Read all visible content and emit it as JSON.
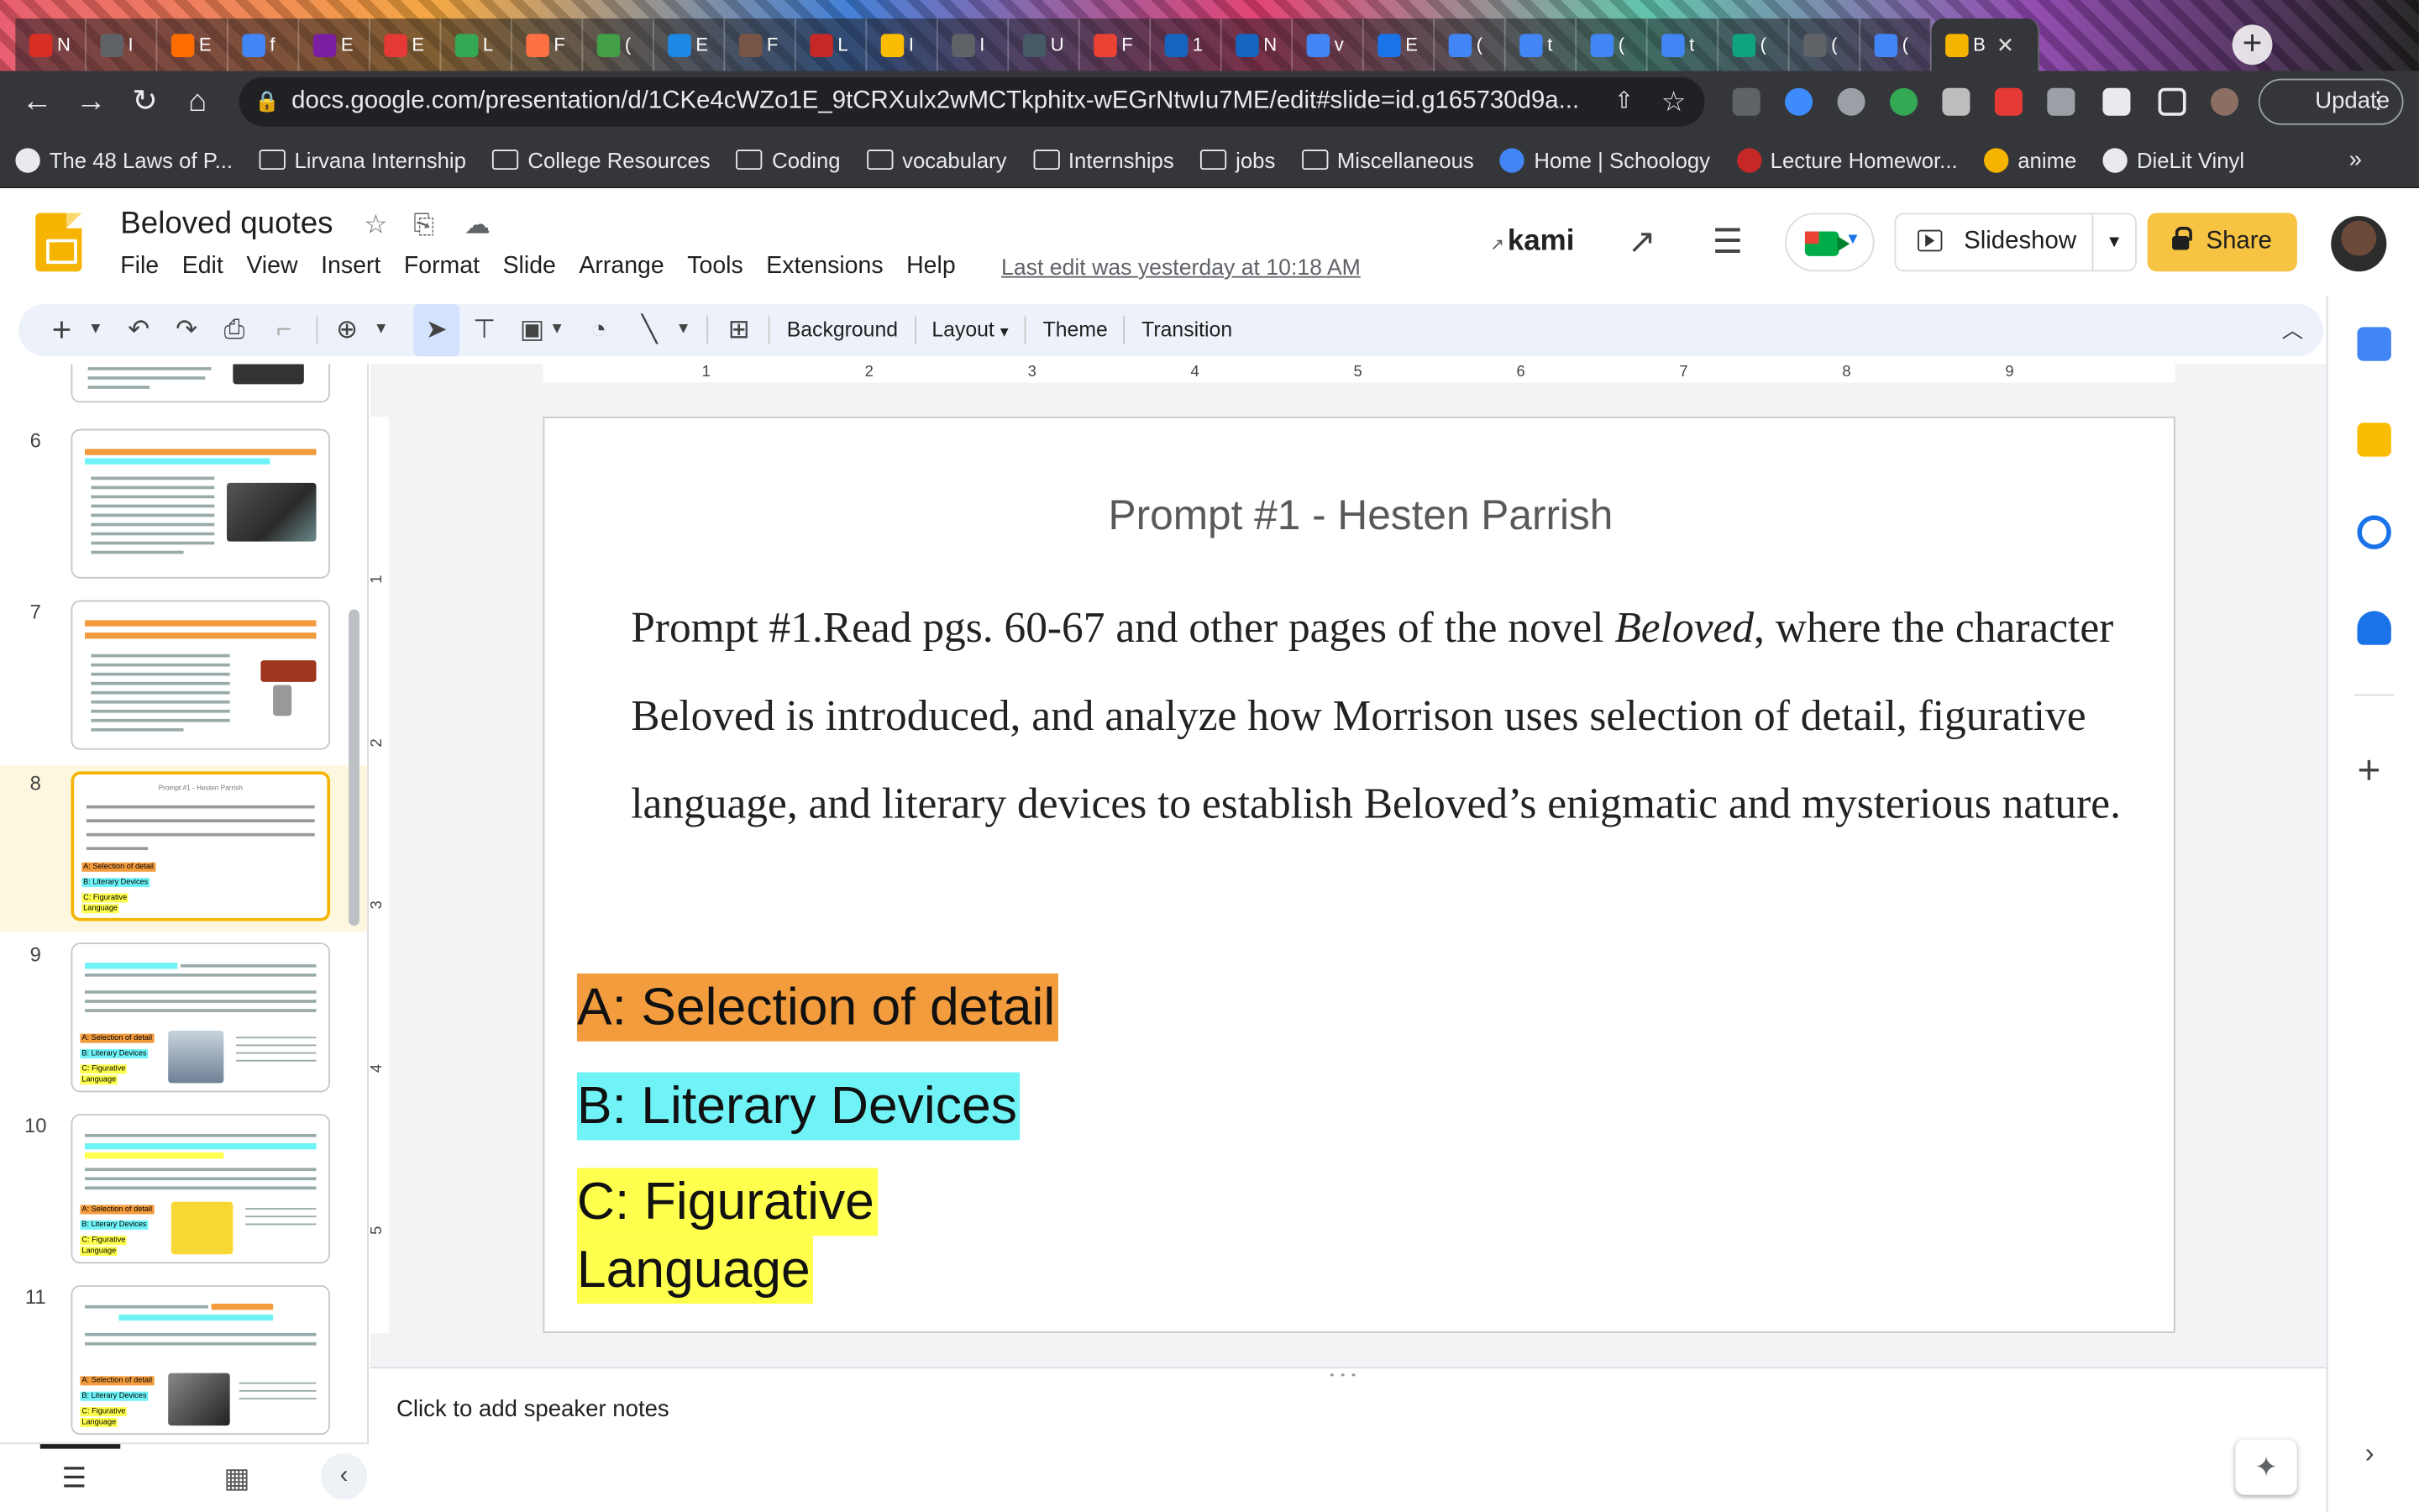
{
  "browser": {
    "tabs": [
      {
        "label": "N",
        "color": "#d93025"
      },
      {
        "label": "I",
        "color": "#5f6368"
      },
      {
        "label": "E",
        "color": "#ff6d00"
      },
      {
        "label": "f",
        "color": "#4285f4"
      },
      {
        "label": "E",
        "color": "#7b1fa2"
      },
      {
        "label": "E",
        "color": "#e53935"
      },
      {
        "label": "L",
        "color": "#34a853"
      },
      {
        "label": "F",
        "color": "#ff7043"
      },
      {
        "label": "(",
        "color": "#43a047"
      },
      {
        "label": "E",
        "color": "#1e88e5"
      },
      {
        "label": "F",
        "color": "#795548"
      },
      {
        "label": "L",
        "color": "#c62828"
      },
      {
        "label": "I",
        "color": "#fbbc04"
      },
      {
        "label": "I",
        "color": "#5f6368"
      },
      {
        "label": "U",
        "color": "#455a64"
      },
      {
        "label": "F",
        "color": "#ea4335"
      },
      {
        "label": "1",
        "color": "#1565c0"
      },
      {
        "label": "N",
        "color": "#1565c0"
      },
      {
        "label": "v",
        "color": "#4285f4"
      },
      {
        "label": "E",
        "color": "#1a73e8"
      },
      {
        "label": "(",
        "color": "#4285f4"
      },
      {
        "label": "t",
        "color": "#4285f4"
      },
      {
        "label": "(",
        "color": "#4285f4"
      },
      {
        "label": "t",
        "color": "#4285f4"
      },
      {
        "label": "(",
        "color": "#10a37f"
      },
      {
        "label": "(",
        "color": "#5f6368"
      },
      {
        "label": "(",
        "color": "#4285f4"
      }
    ],
    "active_tab": {
      "label": "B",
      "color": "#f4b400"
    },
    "new_tab_label": "+",
    "url": "docs.google.com/presentation/d/1CKe4cWZo1E_9tCRXulx2wMCTkphitx-wEGrNtwIu7ME/edit#slide=id.g165730d9a...",
    "update_label": "Update",
    "bookmarks": [
      {
        "label": "The 48 Laws of P...",
        "kind": "site"
      },
      {
        "label": "Lirvana Internship",
        "kind": "folder"
      },
      {
        "label": "College Resources",
        "kind": "folder"
      },
      {
        "label": "Coding",
        "kind": "folder"
      },
      {
        "label": "vocabulary",
        "kind": "folder"
      },
      {
        "label": "Internships",
        "kind": "folder"
      },
      {
        "label": "jobs",
        "kind": "folder"
      },
      {
        "label": "Miscellaneous",
        "kind": "folder"
      },
      {
        "label": "Home | Schoology",
        "kind": "site"
      },
      {
        "label": "Lecture Homewor...",
        "kind": "site"
      },
      {
        "label": "anime",
        "kind": "site"
      },
      {
        "label": "DieLit Vinyl",
        "kind": "site"
      }
    ],
    "bookmarks_more": "»"
  },
  "app": {
    "title": "Beloved quotes",
    "menu": [
      "File",
      "Edit",
      "View",
      "Insert",
      "Format",
      "Slide",
      "Arrange",
      "Tools",
      "Extensions",
      "Help"
    ],
    "last_edit": "Last edit was yesterday at 10:18 AM",
    "kami_label": "kami",
    "slideshow_label": "Slideshow",
    "share_label": "Share"
  },
  "toolbar": {
    "background_label": "Background",
    "layout_label": "Layout",
    "theme_label": "Theme",
    "transition_label": "Transition"
  },
  "ruler": {
    "h": [
      "1",
      "2",
      "3",
      "4",
      "5",
      "6",
      "7",
      "8",
      "9"
    ],
    "v": [
      "1",
      "2",
      "3",
      "4",
      "5"
    ]
  },
  "filmstrip": {
    "slide_numbers": [
      "6",
      "7",
      "8",
      "9",
      "10",
      "11"
    ],
    "selected": "8",
    "thumb_labels": {
      "a": "A: Selection of detail",
      "b": "B: Literary Devices",
      "c1": "C: Figurative",
      "c2": "Language"
    },
    "thumb8_title": "Prompt #1 - Hesten Parrish"
  },
  "slide": {
    "title": "Prompt #1 - Hesten Parrish",
    "body_before": "Prompt #1.Read pgs. 60-67 and other pages of the novel ",
    "body_italic": "Beloved",
    "body_after": ", where the character Beloved is introduced, and analyze how Morrison uses selection of detail, figurative language, and literary devices to establish Beloved’s enigmatic and mysterious nature.",
    "label_a": "A: Selection of detail",
    "label_b": "B: Literary Devices",
    "label_c1": "C: Figurative",
    "label_c2": "Language",
    "colors": {
      "a": "#f39c3e",
      "b": "#6ff3f7",
      "c": "#ffff4d"
    }
  },
  "notes": {
    "placeholder": "Click to add speaker notes"
  }
}
